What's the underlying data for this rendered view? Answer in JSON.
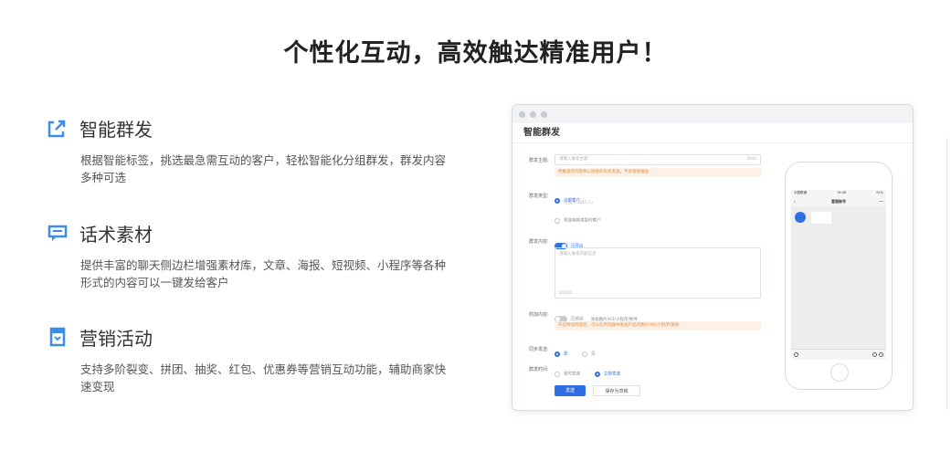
{
  "page": {
    "title": "个性化互动，高效触达精准用户！"
  },
  "features": [
    {
      "icon": "share-export-icon",
      "title": "智能群发",
      "desc": "根据智能标签，挑选最急需互动的客户，轻松智能化分组群发，群发内容多种可选"
    },
    {
      "icon": "chat-bubble-icon",
      "title": "话术素材",
      "desc": "提供丰富的聊天侧边栏增强素材库，文章、海报、短视频、小程序等各种形式的内容可以一键发给客户"
    },
    {
      "icon": "calendar-icon",
      "title": "营销活动",
      "desc": "支持多阶裂变、拼团、抽奖、红包、优惠券等营销互动功能，辅助商家快速变现"
    }
  ],
  "mockup": {
    "heading": "智能群发",
    "form": {
      "topic_label": "群发主题:",
      "topic_placeholder": "请输入群发主题",
      "topic_counter": "0/40",
      "topic_warning": "所推送的内容将以链接的形式发送，不会直接推送",
      "type_label": "群发类型:",
      "type_option1": "全部客户",
      "type_option1_sub": "(已选中 1043 人)",
      "type_option2": "筛选特殊类型的客户",
      "content_label": "群发内容:",
      "content_toggle": "已开启",
      "content_placeholder": "请输入群发内容信息",
      "content_counter": "0/1000",
      "attach_label": "附加内容:",
      "attach_toggle": "已关闭",
      "attach_hint": "添加图片/H5/小程序/附件",
      "attach_warning": "开启附加内容后，可以在所选群中发送产品的图片/H5/小程序/链接",
      "sync_label": "同步发送:",
      "sync_yes": "是",
      "sync_no": "否",
      "time_label": "群发时间:",
      "time_option1": "定时发送",
      "time_option2": "立即发送",
      "send_button": "发送",
      "save_button": "保存为草稿"
    },
    "phone": {
      "time": "19:46",
      "carrier": "中国联通",
      "battery": "91%",
      "chat_title": "客服账号"
    }
  },
  "colors": {
    "accent": "#2f6fe4",
    "icon": "#3a8ee6",
    "warning": "#e08b45"
  }
}
